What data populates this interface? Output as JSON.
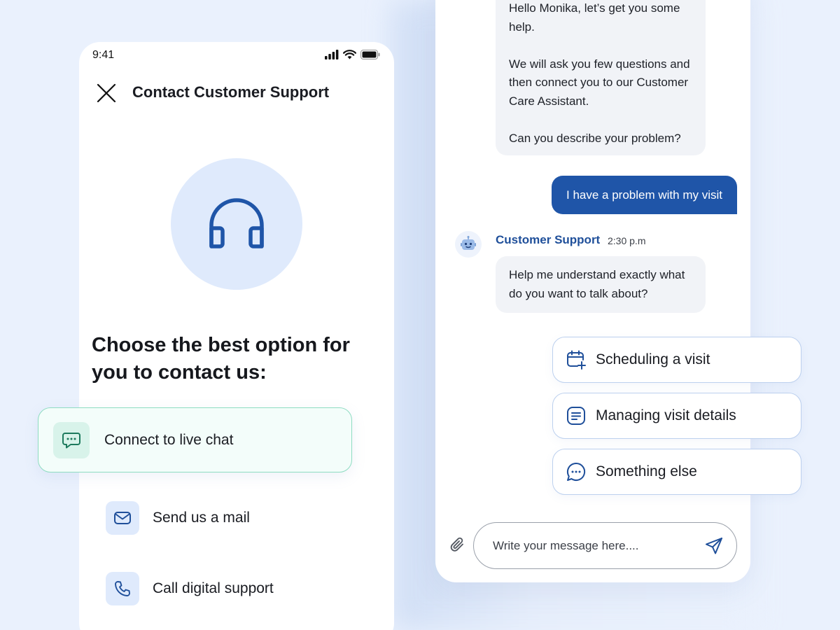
{
  "phone": {
    "status_time": "9:41",
    "title": "Contact Customer Support",
    "heading": "Choose the best option for you to contact us:",
    "options": [
      {
        "label": "Connect to live chat",
        "icon": "chat-bubble-icon",
        "selected": true
      },
      {
        "label": "Send us a mail",
        "icon": "mail-icon"
      },
      {
        "label": "Call digital support",
        "icon": "phone-icon"
      }
    ],
    "hero_icon": "headphones-icon"
  },
  "chat": {
    "bot_message_1": "Hello Monika, let’s get you some help.\n\nWe will ask you few questions and then connect you to our Customer Care Assistant.\n\nCan you describe your problem?",
    "user_message": "I have a problem with my visit",
    "bot_name": "Customer Support",
    "bot_time": "2:30 p.m",
    "bot_message_2": "Help me understand exactly what do you want to talk about?",
    "quick_replies": [
      {
        "label": "Scheduling a visit",
        "icon": "calendar-plus-icon"
      },
      {
        "label": "Managing visit details",
        "icon": "document-list-icon"
      },
      {
        "label": "Something else",
        "icon": "chat-dots-icon"
      }
    ],
    "input_placeholder": "Write your message here....",
    "attach_icon": "paperclip-icon",
    "send_icon": "send-icon"
  },
  "colors": {
    "primary": "#1f55a8",
    "accent_light": "#dfeafc",
    "selected_border": "#8fdcc2",
    "background": "#eaf1fd"
  }
}
